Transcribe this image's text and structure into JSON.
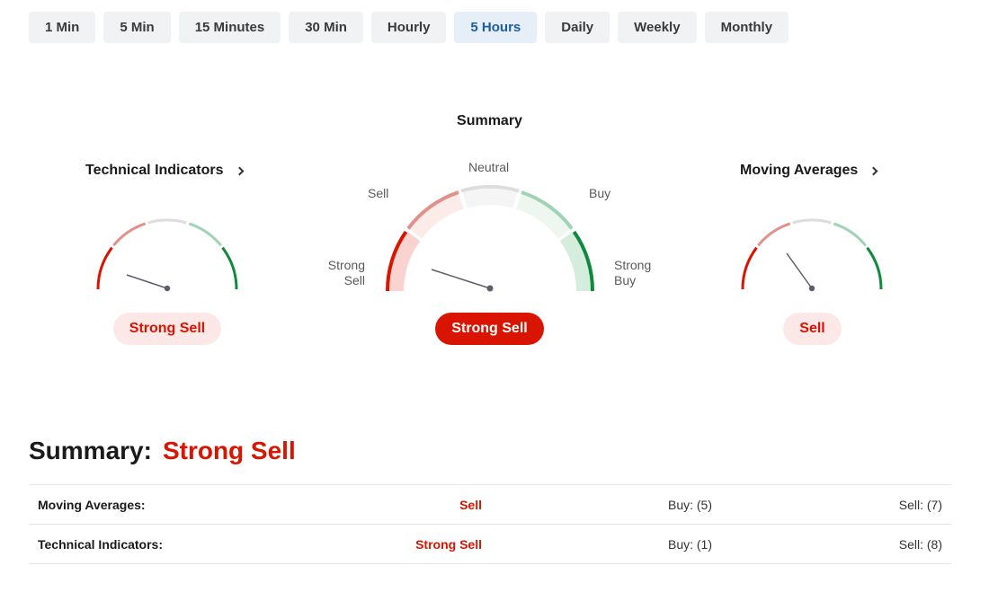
{
  "timeframes": [
    {
      "label": "1 Min",
      "active": false
    },
    {
      "label": "5 Min",
      "active": false
    },
    {
      "label": "15 Minutes",
      "active": false
    },
    {
      "label": "30 Min",
      "active": false
    },
    {
      "label": "Hourly",
      "active": false
    },
    {
      "label": "5 Hours",
      "active": true
    },
    {
      "label": "Daily",
      "active": false
    },
    {
      "label": "Weekly",
      "active": false
    },
    {
      "label": "Monthly",
      "active": false
    }
  ],
  "summary_gauge": {
    "title": "Summary",
    "labels": {
      "neutral": "Neutral",
      "sell": "Sell",
      "buy": "Buy",
      "strong_sell": "Strong\nSell",
      "strong_buy": "Strong\nBuy"
    },
    "verdict": "Strong Sell"
  },
  "technical_indicators": {
    "title": "Technical Indicators",
    "verdict": "Strong Sell"
  },
  "moving_averages": {
    "title": "Moving Averages",
    "verdict": "Sell"
  },
  "summary_line": {
    "label": "Summary:",
    "value": "Strong Sell"
  },
  "table": [
    {
      "name": "Moving Averages:",
      "signal": "Sell",
      "buy": "Buy: (5)",
      "sell": "Sell: (7)"
    },
    {
      "name": "Technical Indicators:",
      "signal": "Strong Sell",
      "buy": "Buy: (1)",
      "sell": "Sell: (8)"
    }
  ],
  "colors": {
    "strong_sell": "#d91400",
    "sell": "#e0918a",
    "neutral": "#dddddd",
    "buy": "#9fd3b3",
    "strong_buy": "#0f8a3c",
    "active_tab_bg": "#e6eef7",
    "active_tab_text": "#1a5ea8"
  }
}
